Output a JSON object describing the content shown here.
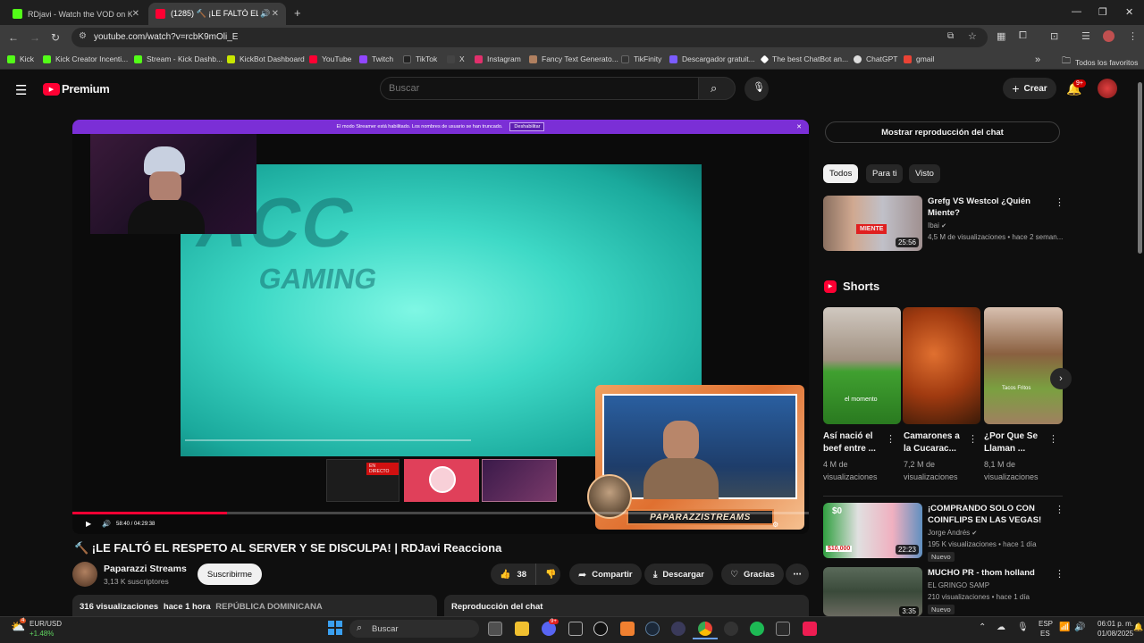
{
  "browser": {
    "tabs": [
      {
        "label": "RDjavi - Watch the VOD on Kick",
        "color": "#53fc18"
      },
      {
        "label": "(1285) 🔨 ¡LE FALTÓ EL RES",
        "color": "#ff0033"
      }
    ],
    "new_tab": "+",
    "url": "youtube.com/watch?v=rcbK9mOli_E",
    "bookmarks": [
      {
        "label": "Kick",
        "color": "#53fc18"
      },
      {
        "label": "Kick Creator Incenti...",
        "color": "#53fc18"
      },
      {
        "label": "Stream - Kick Dashb...",
        "color": "#53fc18"
      },
      {
        "label": "KickBot Dashboard",
        "color": "#c8e600"
      },
      {
        "label": "YouTube",
        "color": "#ff0033"
      },
      {
        "label": "Twitch",
        "color": "#9146ff"
      },
      {
        "label": "TikTok",
        "color": "#222222"
      },
      {
        "label": "X",
        "color": "#444444"
      },
      {
        "label": "Instagram",
        "color": "#e1306c"
      },
      {
        "label": "Fancy Text Generato...",
        "color": "#b08060"
      },
      {
        "label": "TikFinity",
        "color": "#333333"
      },
      {
        "label": "Descargador gratuit...",
        "color": "#7b5cff"
      },
      {
        "label": "The best ChatBot an...",
        "color": "#ffffff"
      },
      {
        "label": "ChatGPT",
        "color": "#dddddd"
      },
      {
        "label": "gmail",
        "color": "#ea4335"
      }
    ],
    "bookmarks_overflow": "»",
    "all_favorites": "Todos los favoritos"
  },
  "youtube": {
    "logo_text": "Premium",
    "search_placeholder": "Buscar",
    "create_label": "Crear",
    "notif_count": "9+"
  },
  "player": {
    "streamer_mode_text": "El modo Streamer está habilitado. Los nombres de usuario se han truncado.",
    "disable_label": "Deshabilitar",
    "game_text": "GAMING",
    "game_logo": "ACC",
    "live_label": "EN DIRECTO",
    "banner": "PAPARAZZISTREAMS",
    "time": "58:40 / 04:29:38",
    "progress": 0.21
  },
  "video": {
    "title": "🔨 ¡LE FALTÓ EL RESPETO AL SERVER Y SE DISCULPA! | RDJavi Reacciona",
    "channel": "Paparazzi Streams",
    "subscribers": "3,13 K suscriptores",
    "subscribe_label": "Suscribirme",
    "likes": "38",
    "share_label": "Compartir",
    "download_label": "Descargar",
    "thanks_label": "Gracias",
    "views": "316 visualizaciones",
    "age": "hace 1 hora",
    "country": "REPÚBLICA DOMINICANA",
    "chat_replay_label": "Reproducción del chat"
  },
  "sidebar": {
    "show_chat_label": "Mostrar reproducción del chat",
    "chips": [
      "Todos",
      "Para ti",
      "Visto"
    ],
    "videos": [
      {
        "title": "Grefg VS Westcol ¿Quién Miente?",
        "channel": "Ibai",
        "meta": "4,5 M de visualizaciones • hace 2 seman...",
        "duration": "25:56",
        "thumb_text": "MIENTE"
      },
      {
        "title": "¡COMPRANDO SOLO CON COINFLIPS EN LAS VEGAS!",
        "channel": "Jorge Andrés",
        "meta": "195 K visualizaciones • hace 1 día",
        "duration": "22:23",
        "badge": "Nuevo",
        "thumb_top": "$0",
        "thumb_bottom": "$10,000"
      },
      {
        "title": "MUCHO PR - thom holland",
        "channel": "EL GRINGO SAMP",
        "meta": "210 visualizaciones • hace 1 día",
        "duration": "3:35",
        "badge": "Nuevo"
      }
    ],
    "shorts_label": "Shorts",
    "shorts": [
      {
        "title": "Así nació el beef entre ...",
        "views": "4 M de visualizaciones",
        "caption": "el momento"
      },
      {
        "title": "Camarones a la Cucarac...",
        "views": "7,2 M de visualizaciones"
      },
      {
        "title": "¿Por Que Se Llaman ...",
        "views": "8,1 M de visualizaciones",
        "caption": "Tacos Fritos"
      }
    ]
  },
  "taskbar": {
    "weather_count": "4",
    "ticker": "EUR/USD",
    "ticker_change": "+1.48%",
    "search_label": "Buscar",
    "lang_top": "ESP",
    "lang_bottom": "ES",
    "time": "06:01 p. m.",
    "date": "01/08/2025",
    "discord_badge": "9+"
  }
}
